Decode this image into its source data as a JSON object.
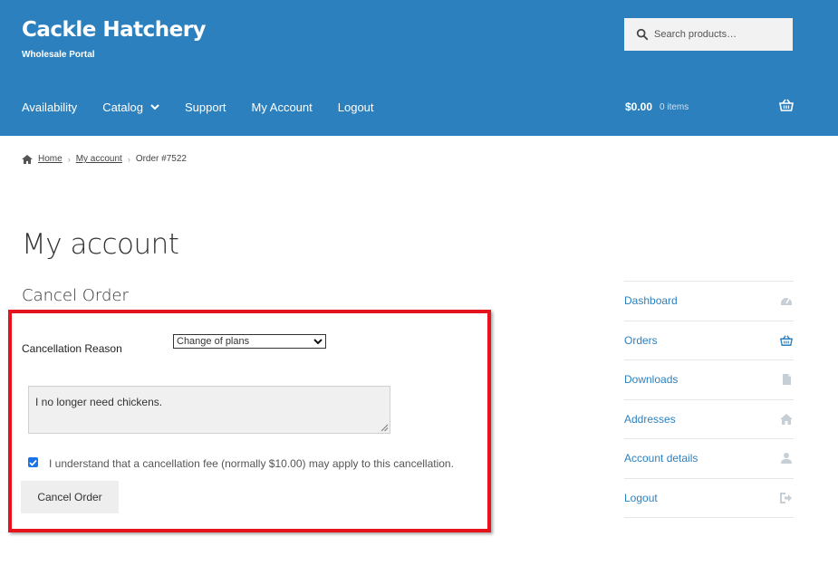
{
  "header": {
    "site_title": "Cackle Hatchery",
    "site_description": "Wholesale Portal",
    "search_placeholder": "Search products…",
    "nav": [
      {
        "label": "Availability"
      },
      {
        "label": "Catalog"
      },
      {
        "label": "Support"
      },
      {
        "label": "My Account"
      },
      {
        "label": "Logout"
      }
    ],
    "cart_total": "$0.00",
    "cart_count": "0 items"
  },
  "breadcrumb": {
    "home": "Home",
    "my_account": "My account",
    "current": "Order #7522"
  },
  "main": {
    "page_title": "My account",
    "section_title": "Cancel Order",
    "reason_label": "Cancellation Reason",
    "reason_selected": "Change of plans",
    "reason_text": "I no longer need chickens.",
    "ack_checked": true,
    "ack_label": "I understand that a cancellation fee (normally $10.00) may apply to this cancellation.",
    "cancel_button": "Cancel Order"
  },
  "account_nav": [
    {
      "label": "Dashboard",
      "icon": "dashboard-icon"
    },
    {
      "label": "Orders",
      "icon": "basket-icon"
    },
    {
      "label": "Downloads",
      "icon": "file-icon"
    },
    {
      "label": "Addresses",
      "icon": "home-icon"
    },
    {
      "label": "Account details",
      "icon": "user-icon"
    },
    {
      "label": "Logout",
      "icon": "sign-out-icon"
    }
  ],
  "colors": {
    "header_bg": "#2c80bd",
    "highlight_border": "#e5131b",
    "link": "#2c80bd"
  }
}
